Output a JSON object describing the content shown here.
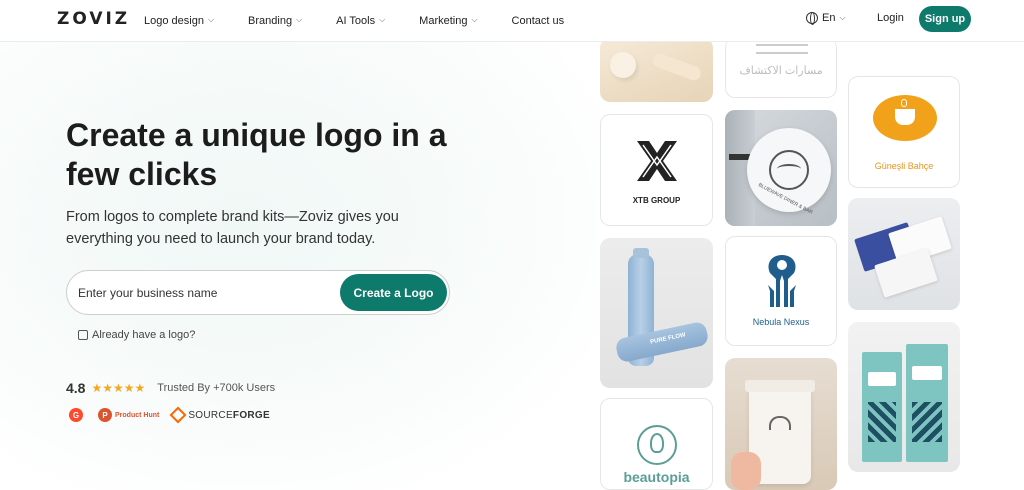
{
  "header": {
    "brand": "ZOVIZ",
    "nav": [
      {
        "label": "Logo design",
        "has_dropdown": true
      },
      {
        "label": "Branding",
        "has_dropdown": true
      },
      {
        "label": "AI Tools",
        "has_dropdown": true
      },
      {
        "label": "Marketing",
        "has_dropdown": true
      },
      {
        "label": "Contact us",
        "has_dropdown": false
      }
    ],
    "language": "En",
    "login_label": "Login",
    "signup_label": "Sign up"
  },
  "hero": {
    "title": "Create a unique logo in a few clicks",
    "subtitle": "From logos to complete brand kits—Zoviz gives you everything you need to launch your brand today.",
    "search": {
      "placeholder": "Enter your business name",
      "value": ""
    },
    "create_button": "Create a Logo",
    "have_logo_link": "Already have a logo?",
    "rating": {
      "score": "4.8",
      "stars": 5,
      "trusted_text": "Trusted By +700k Users"
    },
    "badges": [
      {
        "name": "G2",
        "label": "G"
      },
      {
        "name": "Product Hunt",
        "label": "Product Hunt"
      },
      {
        "name": "SourceForge",
        "label_light": "SOURCE",
        "label_bold": "FORGE"
      }
    ]
  },
  "gallery": {
    "cards": [
      {
        "label": "مسارات الاكتشاف"
      },
      {
        "label": "XTB GROUP"
      },
      {
        "label": "BLUEWAVE DINER & BAR"
      },
      {
        "label": "Güneşli Bahçe"
      },
      {
        "label": "PURE FLOW"
      },
      {
        "label": "Nebula Nexus"
      },
      {
        "label": "beautopia"
      }
    ]
  },
  "colors": {
    "accent": "#0d7a6c",
    "star": "#f5a623",
    "g2": "#ff492c",
    "product_hunt": "#da552f",
    "sourceforge": "#ff6600",
    "sunny_orange": "#f2a21a",
    "nebula_blue": "#1f5e8c",
    "beautopia_teal": "#5a9e96"
  }
}
